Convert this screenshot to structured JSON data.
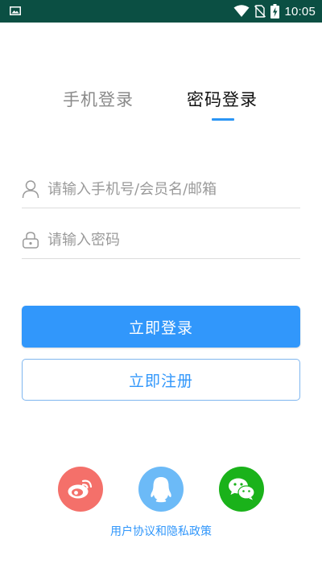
{
  "status_bar": {
    "time": "10:05",
    "icons": [
      "gallery-icon",
      "wifi-icon",
      "no-sim-icon",
      "battery-charging-icon"
    ]
  },
  "tabs": [
    {
      "label": "手机登录",
      "active": false
    },
    {
      "label": "密码登录",
      "active": true
    }
  ],
  "form": {
    "account_placeholder": "请输入手机号/会员名/邮箱",
    "account_value": "",
    "password_placeholder": "请输入密码",
    "password_value": ""
  },
  "buttons": {
    "login_label": "立即登录",
    "register_label": "立即注册"
  },
  "social": {
    "icons": [
      "weibo-icon",
      "qq-icon",
      "wechat-icon"
    ]
  },
  "agreement_text": "用户协议和隐私政策",
  "colors": {
    "status_bar_bg": "#0b4f43",
    "accent": "#3197fb",
    "weibo": "#f4706a",
    "qq": "#6cbaf7",
    "wechat": "#1ab21a"
  }
}
